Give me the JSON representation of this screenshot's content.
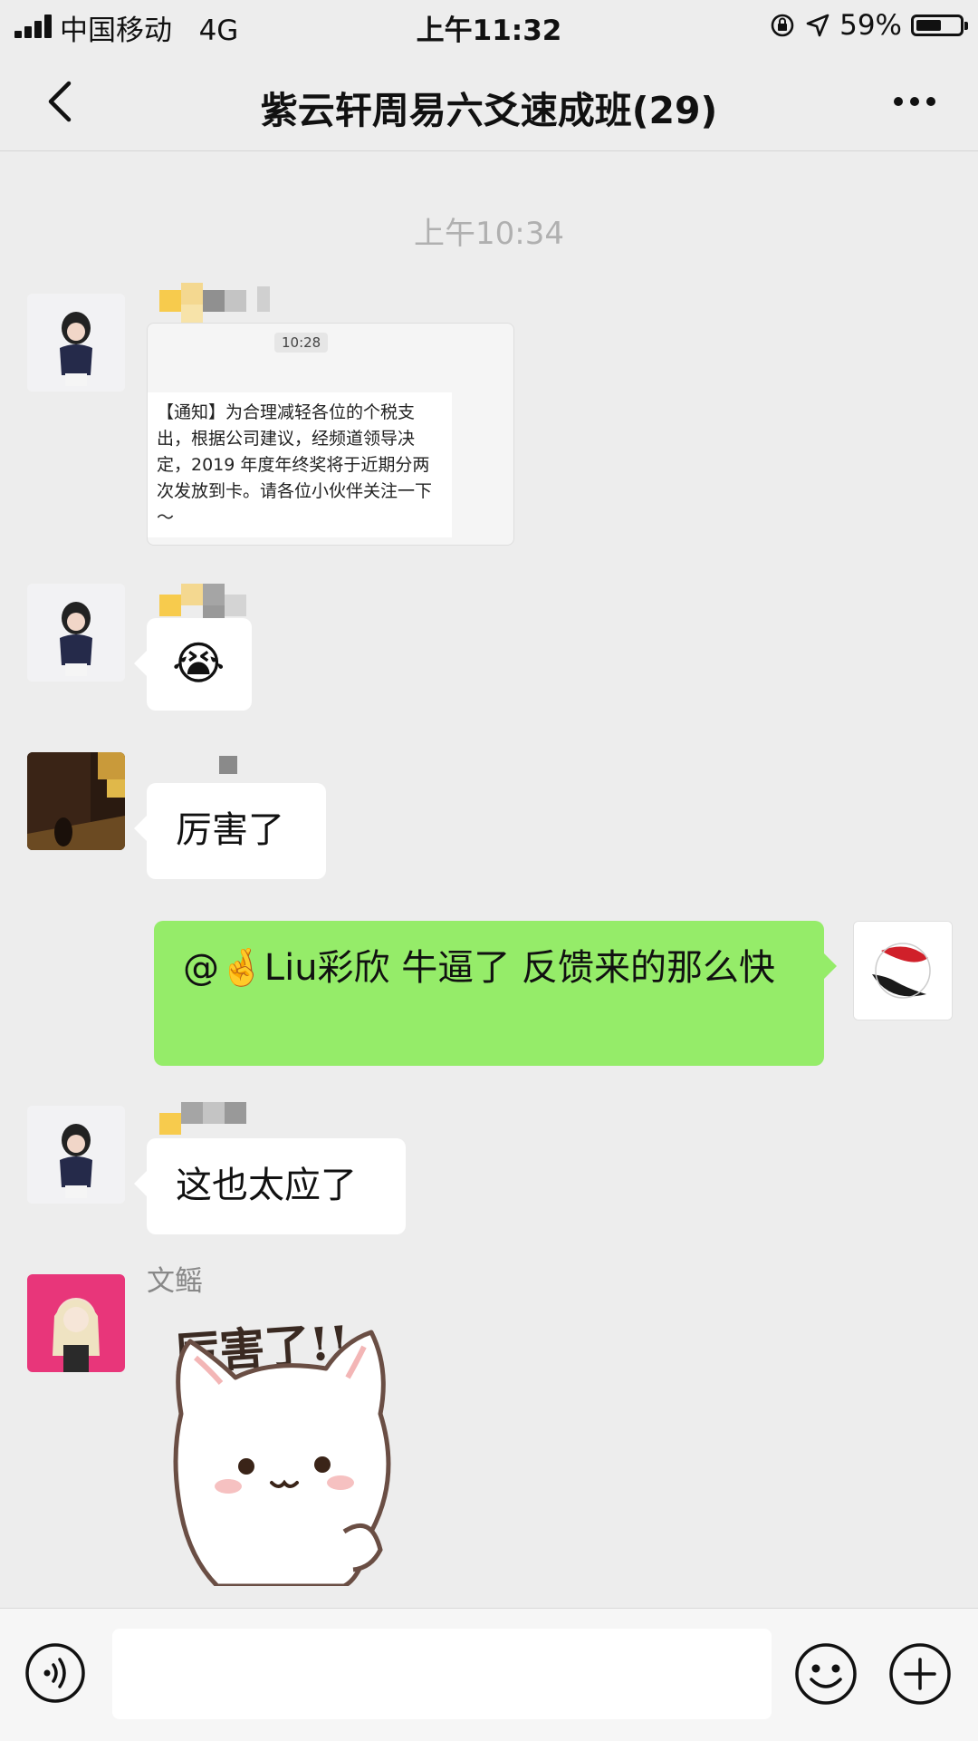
{
  "status_bar": {
    "carrier": "中国移动",
    "network": "4G",
    "time": "上午11:32",
    "battery_percent": "59%",
    "battery_level": 0.59
  },
  "nav": {
    "title": "紫云轩周易六爻速成班(29)"
  },
  "timestamp": "上午10:34",
  "messages": [
    {
      "image": {
        "time": "10:28",
        "text": "【通知】为合理减轻各位的个税支出，根据公司建议，经频道领导决定，2019 年度年终奖将于近期分两次发放到卡。请各位小伙伴关注一下～"
      }
    },
    {
      "emoji": "😭"
    },
    {
      "text": "厉害了"
    },
    {
      "text": "@🤞Liu彩欣 牛逼了 反馈来的那么快"
    },
    {
      "text": "这也太应了"
    },
    {
      "sender": "文鳐",
      "sticker_text": "厉害了!!"
    }
  ],
  "input": {
    "placeholder": ""
  },
  "icons": {
    "back": "chevron-left-icon",
    "more": "more-dots-icon",
    "voice": "voice-icon",
    "emoji": "smiley-icon",
    "plus": "plus-icon"
  }
}
